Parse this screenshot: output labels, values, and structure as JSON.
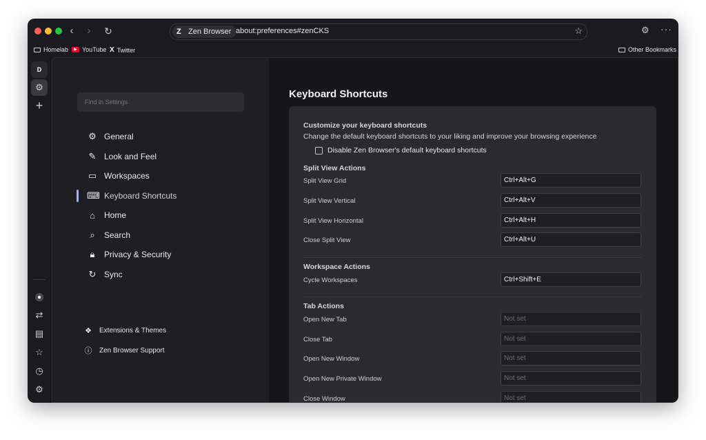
{
  "browser": {
    "url_chip": "Zen Browser",
    "url": "about:preferences#zenCKS",
    "icons": {
      "back": "chevron-left-icon",
      "forward": "chevron-right-icon",
      "reload": "reload-icon",
      "star": "star-icon",
      "extensions": "puzzle-icon",
      "more": "more-icon"
    }
  },
  "bookmarks": [
    {
      "label": "Homelab",
      "icon": "folder-icon"
    },
    {
      "label": "YouTube",
      "icon": "youtube-icon"
    },
    {
      "label": "Twitter",
      "icon": "x-icon"
    }
  ],
  "other_bookmarks": "Other Bookmarks",
  "strip": {
    "workspace_letter": "D"
  },
  "settings": {
    "search_placeholder": "Find in Settings",
    "nav": [
      {
        "label": "General",
        "icon": "gear-icon"
      },
      {
        "label": "Look and Feel",
        "icon": "brush-icon"
      },
      {
        "label": "Workspaces",
        "icon": "window-icon"
      },
      {
        "label": "Keyboard Shortcuts",
        "icon": "keyboard-shortcuts-icon"
      },
      {
        "label": "Home",
        "icon": "home-icon"
      },
      {
        "label": "Search",
        "icon": "search-icon"
      },
      {
        "label": "Privacy & Security",
        "icon": "lock-icon"
      },
      {
        "label": "Sync",
        "icon": "sync-icon"
      }
    ],
    "active_nav": "Keyboard Shortcuts",
    "footer": [
      {
        "label": "Extensions & Themes",
        "icon": "puzzle-icon"
      },
      {
        "label": "Zen Browser Support",
        "icon": "help-icon"
      }
    ]
  },
  "page": {
    "title": "Keyboard Shortcuts",
    "customize_heading": "Customize your keyboard shortcuts",
    "customize_sub": "Change the default keyboard shortcuts to your liking and improve your browsing experience",
    "disable_label": "Disable Zen Browser's default keyboard shortcuts",
    "disable_checked": false,
    "sections": [
      {
        "heading": "Split View Actions",
        "rows": [
          {
            "label": "Split View Grid",
            "value": "Ctrl+Alt+G"
          },
          {
            "label": "Split View Vertical",
            "value": "Ctrl+Alt+V"
          },
          {
            "label": "Split View Horizontal",
            "value": "Ctrl+Alt+H"
          },
          {
            "label": "Close Split View",
            "value": "Ctrl+Alt+U"
          }
        ]
      },
      {
        "heading": "Workspace Actions",
        "rows": [
          {
            "label": "Cycle Workspaces",
            "value": "Ctrl+Shift+E"
          }
        ]
      },
      {
        "heading": "Tab Actions",
        "rows": [
          {
            "label": "Open New Tab",
            "value": "Not set"
          },
          {
            "label": "Close Tab",
            "value": "Not set"
          },
          {
            "label": "Open New Window",
            "value": "Not set"
          },
          {
            "label": "Open New Private Window",
            "value": "Not set"
          },
          {
            "label": "Close Window",
            "value": "Not set"
          }
        ]
      }
    ]
  }
}
